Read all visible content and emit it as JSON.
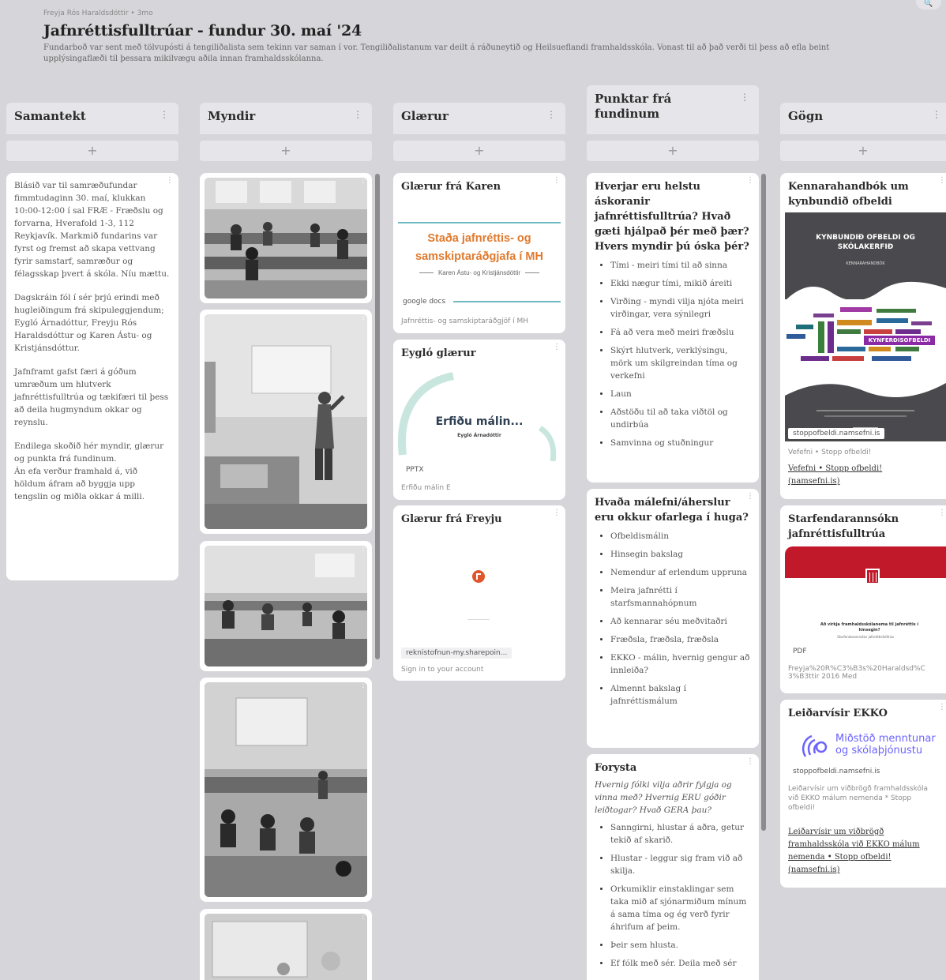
{
  "board": {
    "breadcrumb": "Freyja Rós Haraldsdóttir • 3mo",
    "title": "Jafnréttisfulltrúar - fundur 30. maí '24",
    "description": "Fundarboð var sent með tölvupósti á tengiliðalista sem tekinn var saman í vor. Tengiliðalistanum var deilt á ráðuneytið og Heilsueflandi framhaldsskóla. Vonast til að það verði til þess að efla beint upplýsingaflæði til þessara mikilvægu aðila innan framhaldsskólanna.",
    "search_label": "🔍",
    "add_label": "+",
    "menu_label": "⋮"
  },
  "columns": {
    "samantekt": {
      "title": "Samantekt",
      "card": {
        "p1": "Blásið var til samræðufundar fimmtudaginn 30. maí, klukkan 10:00-12:00 í sal FRÆ - Fræðslu og forvarna, Hverafold 1-3, 112 Reykjavík. Markmið fundarins var fyrst og fremst að skapa vettvang fyrir samstarf, samræður og félagsskap þvert á skóla. Níu mættu.",
        "p2": "Dagskráin fól í sér þrjú erindi með hugleiðingum frá skipuleggjendum; Eygló Árnadóttur, Freyju Rós Haraldsdóttur og Karen Ástu- og Kristjánsdóttur.",
        "p3": "Jafnframt gafst færi á góðum umræðum um hlutverk jafnréttisfulltrúa og tækifæri til þess að deila hugmyndum okkar og reynslu.",
        "p4": "Endilega skoðið hér myndir, glærur og punkta frá fundinum.",
        "p5": "Án efa verður framhald á, við höldum áfram að byggja upp tengslin og miðla okkar á milli."
      }
    },
    "myndir": {
      "title": "Myndir"
    },
    "glaerur": {
      "title": "Glærur",
      "cards": [
        {
          "title": "Glærur frá Karen",
          "slide_title": "Staða jafnréttis- og samskiptaráðgjafa í MH",
          "slide_author": "Karen Ástu- og Kristjánsdóttir",
          "tag": "google docs",
          "caption": "Jafnréttis- og samskiptaráðgjöf í MH"
        },
        {
          "title": "Eygló glærur",
          "slide_title": "Erfiðu málin...",
          "slide_author": "Eygló Árnadóttir",
          "tag": "PPTX",
          "caption": "Erfiðu málin E"
        },
        {
          "title": "Glærur frá Freyju",
          "tag": "reknistofnun-my.sharepoin...",
          "caption": "Sign in to your account"
        }
      ]
    },
    "punktar": {
      "title": "Punktar frá fundinum",
      "cards": [
        {
          "title": "Hverjar eru helstu áskoranir jafnréttisfulltrúa? Hvað gæti hjálpað þér með þær? Hvers myndir þú óska þér?",
          "items": [
            "Tími - meiri tími til að sinna",
            "Ekki nægur tími, mikið áreiti",
            "Virðing - myndi vilja njóta meiri virðingar, vera sýnilegri",
            "Fá að vera með meiri fræðslu",
            "Skýrt hlutverk, verklýsingu, mörk um skilgreindan tíma og verkefni",
            "Laun",
            "Aðstöðu til að taka viðtöl og undirbúa",
            "Samvinna og stuðningur"
          ]
        },
        {
          "title": "Hvaða málefni/áherslur eru okkur ofarlega í huga?",
          "items": [
            "Ofbeldismálin",
            "Hinsegin bakslag",
            "Nemendur af erlendum uppruna",
            "Meira jafnrétti í starfsmannahópnum",
            "Að kennarar séu meðvitaðri",
            "Fræðsla, fræðsla, fræðsla",
            "EKKO - málin, hvernig gengur að innleiða?",
            "Almennt bakslag í jafnréttismálum"
          ]
        },
        {
          "title": "Forysta",
          "intro": "Hvernig fólki vilja aðrir fylgja og vinna með? Hvernig ERU góðir leiðtogar? Hvað GERA þau?",
          "items": [
            "Sanngirni, hlustar á aðra, getur tekið af skarið.",
            "Hlustar - leggur sig fram við að skilja.",
            "Orkumiklir einstaklingar sem taka mið af sjónarmiðum mínum á sama tíma og ég verð fyrir áhrifum af þeim.",
            "Þeir sem hlusta.",
            "Ef fólk með sér. Deila með sér"
          ]
        }
      ]
    },
    "gogn": {
      "title": "Gögn",
      "cards": [
        {
          "title": "Kennarahandbók um kynbundið ofbeldi",
          "cover_title": "KYNBUNDIÐ OFBELDI OG SKÓLAKERFIÐ",
          "cover_sub": "KENNARAHANDBÓK",
          "cloud_main": "KYNFERÐISOFBELDI",
          "tag": "stoppofbeldi.namsefni.is",
          "caption": "Vefefni • Stopp ofbeldi!",
          "link": "Vefefni • Stopp ofbeldi! (namsefni.is)"
        },
        {
          "title": "Starfendarannsókn jafnréttisfulltrúa",
          "doc_title": "Að virkja framhaldsskólanema til jafnréttis í hinsegin?",
          "doc_sub": "Starfendarannsókn jafnréttisfulltrúa",
          "tag": "PDF",
          "caption": "Freyja%20R%C3%B3s%20Haraldsd%C3%B3ttir 2016 Med"
        },
        {
          "title": "Leiðarvísir EKKO",
          "logo_text": "Miðstöð menntunar og skólaþjónustu",
          "tag": "stoppofbeldi.namsefni.is",
          "caption": "Leiðarvísir um viðbrögð framhaldsskóla við EKKO málum nemenda * Stopp ofbeldi!",
          "link": "Leiðarvísir um viðbrögð framhaldsskóla við EKKO málum nemenda • Stopp ofbeldi! (namsefni.is)"
        }
      ]
    }
  }
}
